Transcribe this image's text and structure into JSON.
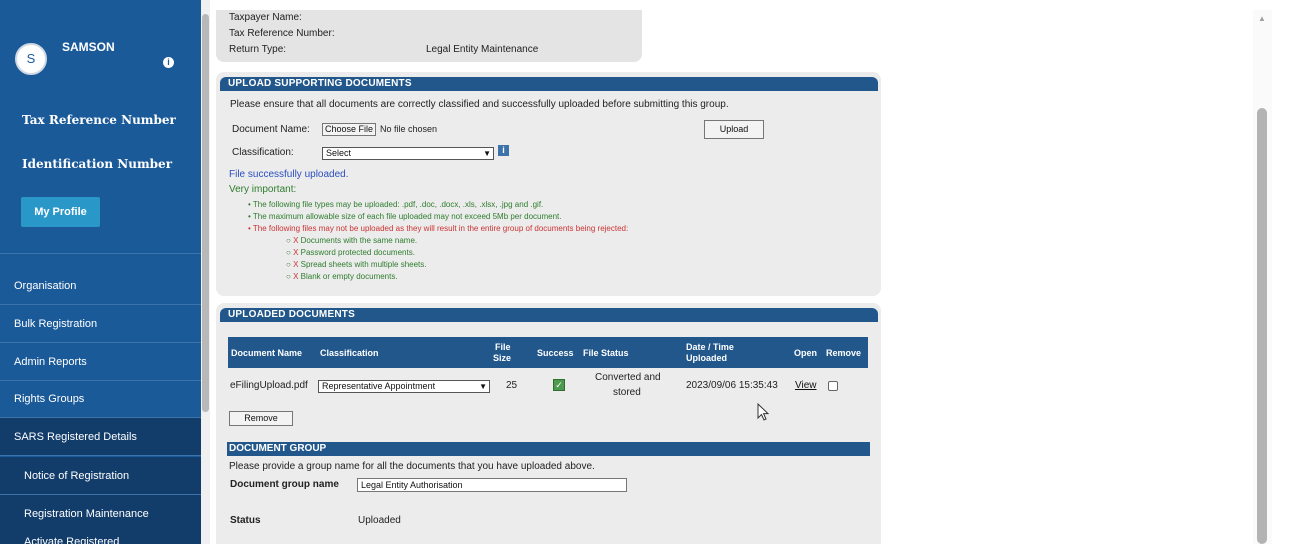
{
  "user": {
    "initial": "S",
    "name": "SAMSON",
    "info_icon": "i"
  },
  "sidebar": {
    "tax_ref_label": "Tax Reference Number",
    "id_label": "Identification Number",
    "my_profile": "My Profile",
    "nav": [
      {
        "label": "Organisation"
      },
      {
        "label": "Bulk Registration"
      },
      {
        "label": "Admin Reports"
      },
      {
        "label": "Rights Groups"
      },
      {
        "label": "SARS Registered Details"
      },
      {
        "label": "Notice of Registration"
      },
      {
        "label": "Registration Maintenance"
      },
      {
        "label": "Activate Registered"
      }
    ]
  },
  "taxpayer": {
    "name_label": "Taxpayer Name:",
    "ref_label": "Tax Reference Number:",
    "return_type_label": "Return Type:",
    "return_type_value": "Legal Entity Maintenance"
  },
  "upload": {
    "header": "UPLOAD SUPPORTING DOCUMENTS",
    "instruction": "Please ensure that all documents are correctly classified and successfully uploaded before submitting this group.",
    "doc_name_label": "Document Name:",
    "choose_file": "Choose File",
    "no_file": "No file chosen",
    "upload_button": "Upload",
    "classification_label": "Classification:",
    "classification_value": "Select",
    "success_msg": "File successfully uploaded.",
    "very_important": "Very important:",
    "rules": [
      "The following file types may be uploaded: .pdf, .doc, .docx, .xls, .xlsx, .jpg and .gif.",
      "The maximum allowable size of each file uploaded may not exceed 5Mb per document.",
      "The following files may not be uploaded as they will result in the entire group of documents being rejected:"
    ],
    "rejected": [
      "Documents with the same name.",
      "Password protected documents.",
      "Spread sheets with multiple sheets.",
      "Blank or empty documents."
    ],
    "x_mark": "X"
  },
  "uploaded": {
    "header": "UPLOADED DOCUMENTS",
    "columns": {
      "doc_name": "Document Name",
      "classification": "Classification",
      "file_size_1": "File",
      "file_size_2": "Size",
      "success": "Success",
      "file_status": "File Status",
      "date_1": "Date / Time",
      "date_2": "Uploaded",
      "open": "Open",
      "remove": "Remove"
    },
    "row": {
      "doc_name": "eFilingUpload.pdf",
      "classification": "Representative Appointment",
      "file_size": "25",
      "status_1": "Converted and",
      "status_2": "stored",
      "date": "2023/09/06 15:35:43",
      "open": "View"
    },
    "remove_button": "Remove"
  },
  "group": {
    "header": "DOCUMENT GROUP",
    "instruction": "Please provide a group name for all the documents that you have uploaded above.",
    "name_label": "Document group name",
    "name_value": "Legal Entity Authorisation",
    "status_label": "Status",
    "status_value": "Uploaded"
  }
}
